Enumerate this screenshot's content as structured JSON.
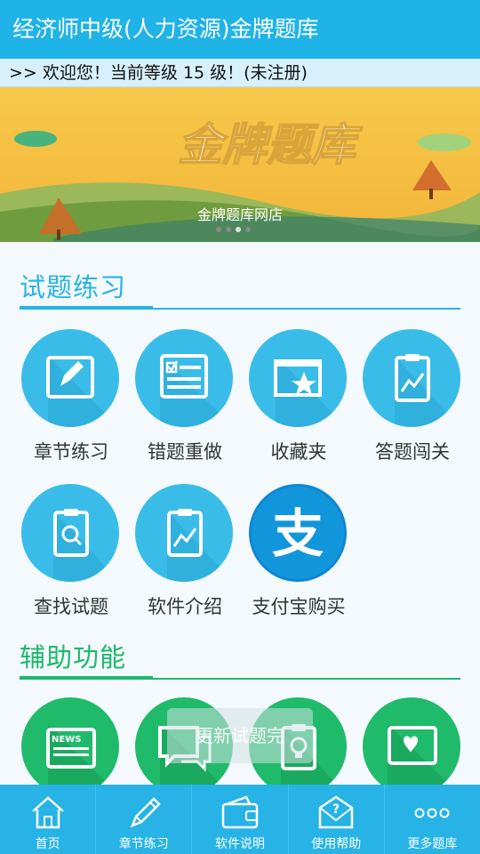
{
  "app": {
    "title": "经济师中级(人力资源)金牌题库"
  },
  "notice": "&gt;&gt; 欢迎您！当前等级 15 级！(未注册)",
  "banner": {
    "logo_text": "金牌题库",
    "caption": "金牌题库网店",
    "slide_count": 4,
    "active_slide": 3
  },
  "sections": {
    "practice": {
      "title": "试题练习",
      "color": "#27b3e6",
      "items": [
        {
          "label": "章节练习",
          "icon": "pencil-board-icon"
        },
        {
          "label": "错题重做",
          "icon": "check-form-icon"
        },
        {
          "label": "收藏夹",
          "icon": "star-folder-icon"
        },
        {
          "label": "答题闯关",
          "icon": "chart-clipboard-icon"
        },
        {
          "label": "查找试题",
          "icon": "search-clipboard-icon"
        },
        {
          "label": "软件介绍",
          "icon": "chart-clipboard-icon"
        },
        {
          "label": "支付宝购买",
          "icon": "alipay-icon"
        }
      ]
    },
    "assist": {
      "title": "辅助功能",
      "color": "#1cb86b",
      "items": [
        {
          "label": "",
          "icon": "news-icon"
        },
        {
          "label": "",
          "icon": "chat-bubble-icon"
        },
        {
          "label": "",
          "icon": "lightbulb-clipboard-icon"
        },
        {
          "label": "",
          "icon": "heart-window-icon"
        }
      ]
    }
  },
  "toast": "更新试题完",
  "tabs": [
    {
      "label": "首页",
      "icon": "home-icon"
    },
    {
      "label": "章节练习",
      "icon": "pencil-icon"
    },
    {
      "label": "软件说明",
      "icon": "wallet-icon"
    },
    {
      "label": "使用帮助",
      "icon": "help-mail-icon"
    },
    {
      "label": "更多题库",
      "icon": "more-dots-icon"
    }
  ]
}
